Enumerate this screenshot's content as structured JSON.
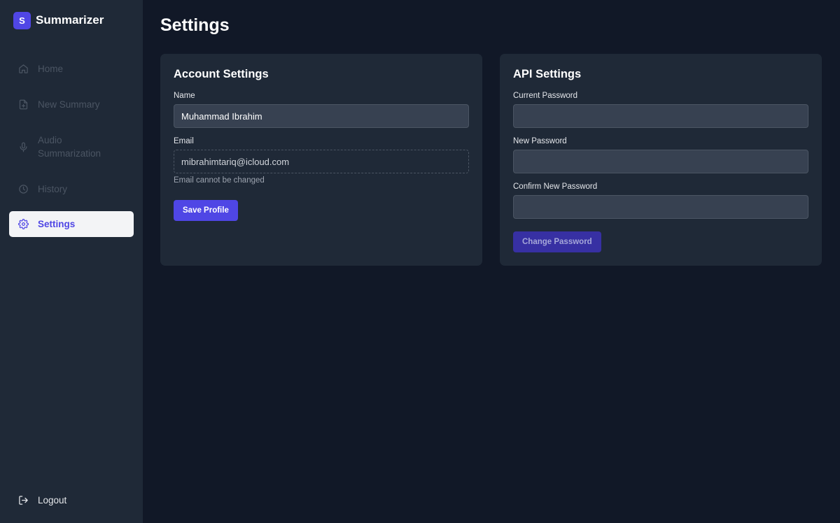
{
  "brand": {
    "logo_letter": "S",
    "name": "Summarizer"
  },
  "sidebar": {
    "items": [
      {
        "label": "Home",
        "icon": "home-icon"
      },
      {
        "label": "New Summary",
        "icon": "file-plus-icon"
      },
      {
        "label": "Audio Summarization",
        "icon": "microphone-icon"
      },
      {
        "label": "History",
        "icon": "clock-icon"
      },
      {
        "label": "Settings",
        "icon": "gear-icon",
        "active": true
      }
    ],
    "logout_label": "Logout"
  },
  "page": {
    "title": "Settings"
  },
  "account": {
    "title": "Account Settings",
    "name_label": "Name",
    "name_value": "Muhammad Ibrahim",
    "email_label": "Email",
    "email_value": "mibrahimtariq@icloud.com",
    "email_help": "Email cannot be changed",
    "save_label": "Save Profile"
  },
  "api": {
    "title": "API Settings",
    "current_password_label": "Current Password",
    "new_password_label": "New Password",
    "confirm_password_label": "Confirm New Password",
    "change_label": "Change Password"
  },
  "colors": {
    "accent": "#4f46e5",
    "sidebar_bg": "#1f2937",
    "page_bg": "#111827"
  }
}
